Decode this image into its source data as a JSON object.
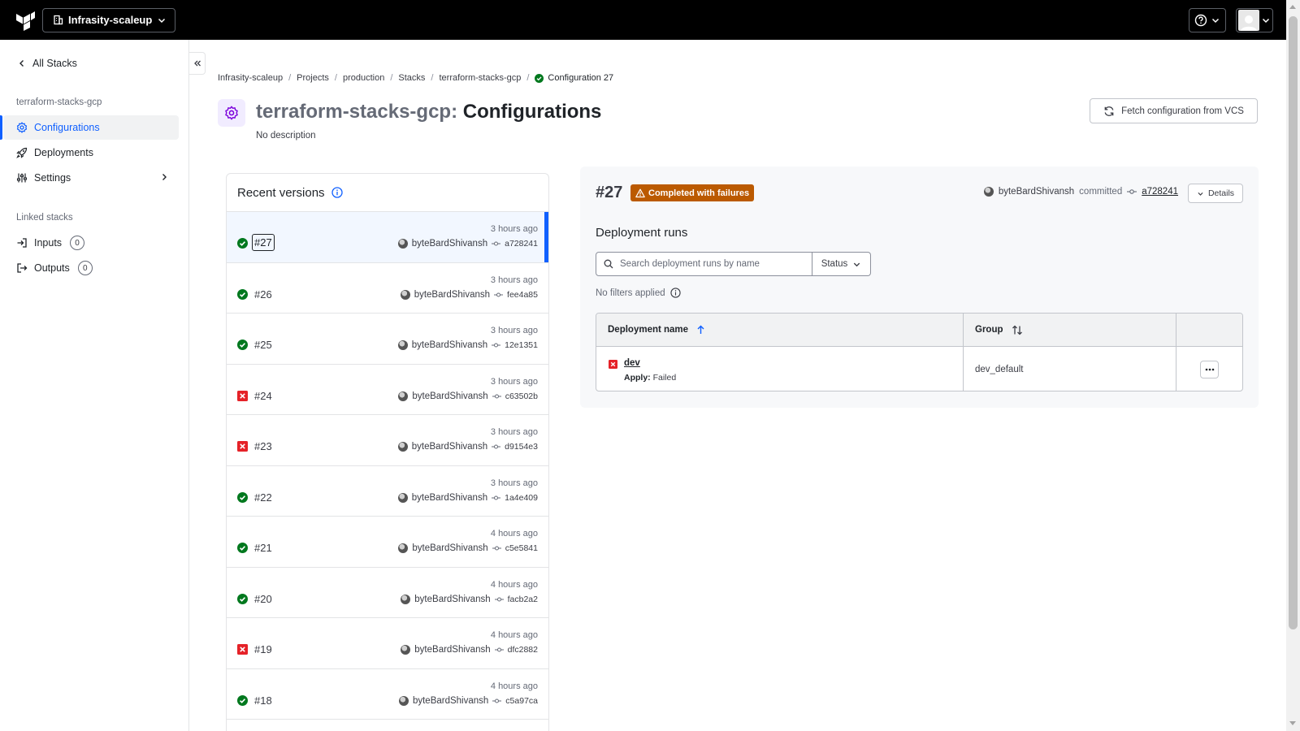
{
  "org": {
    "name": "Infrasity-scaleup"
  },
  "sidebar": {
    "back_label": "All Stacks",
    "stack_name": "terraform-stacks-gcp",
    "items": [
      {
        "label": "Configurations",
        "icon": "gear-icon",
        "active": true
      },
      {
        "label": "Deployments",
        "icon": "rocket-icon"
      },
      {
        "label": "Settings",
        "icon": "sliders-icon"
      }
    ],
    "linked_heading": "Linked stacks",
    "linked": [
      {
        "label": "Inputs",
        "count": "0",
        "icon": "login-icon"
      },
      {
        "label": "Outputs",
        "count": "0",
        "icon": "logout-icon"
      }
    ]
  },
  "breadcrumb": [
    "Infrasity-scaleup",
    "Projects",
    "production",
    "Stacks",
    "terraform-stacks-gcp",
    "Configuration 27"
  ],
  "page": {
    "title_prefix": "terraform-stacks-gcp:",
    "title_suffix": "Configurations",
    "description": "No description",
    "fetch_label": "Fetch configuration from VCS"
  },
  "versions": {
    "title": "Recent versions",
    "rows": [
      {
        "num": "#27",
        "status": "success",
        "time": "3 hours ago",
        "author": "byteBardShivansh",
        "sha": "a728241",
        "selected": true
      },
      {
        "num": "#26",
        "status": "success",
        "time": "3 hours ago",
        "author": "byteBardShivansh",
        "sha": "fee4a85"
      },
      {
        "num": "#25",
        "status": "success",
        "time": "3 hours ago",
        "author": "byteBardShivansh",
        "sha": "12e1351"
      },
      {
        "num": "#24",
        "status": "failed",
        "time": "3 hours ago",
        "author": "byteBardShivansh",
        "sha": "c63502b"
      },
      {
        "num": "#23",
        "status": "failed",
        "time": "3 hours ago",
        "author": "byteBardShivansh",
        "sha": "d9154e3"
      },
      {
        "num": "#22",
        "status": "success",
        "time": "3 hours ago",
        "author": "byteBardShivansh",
        "sha": "1a4e409"
      },
      {
        "num": "#21",
        "status": "success",
        "time": "4 hours ago",
        "author": "byteBardShivansh",
        "sha": "c5e5841"
      },
      {
        "num": "#20",
        "status": "success",
        "time": "4 hours ago",
        "author": "byteBardShivansh",
        "sha": "facb2a2"
      },
      {
        "num": "#19",
        "status": "failed",
        "time": "4 hours ago",
        "author": "byteBardShivansh",
        "sha": "dfc2882"
      },
      {
        "num": "#18",
        "status": "success",
        "time": "4 hours ago",
        "author": "byteBardShivansh",
        "sha": "c5a97ca"
      }
    ]
  },
  "details": {
    "num": "#27",
    "status_label": "Completed with failures",
    "author": "byteBardShivansh",
    "verb": "committed",
    "sha": "a728241",
    "details_label": "Details",
    "deployment_runs_title": "Deployment runs",
    "search_placeholder": "Search deployment runs by name",
    "status_filter_label": "Status",
    "no_filters": "No filters applied",
    "table": {
      "col_name": "Deployment name",
      "col_group": "Group",
      "rows": [
        {
          "name": "dev",
          "apply_label": "Apply:",
          "apply_status": "Failed",
          "group": "dev_default"
        }
      ]
    }
  },
  "colors": {
    "accent": "#1060ff",
    "success": "#00781e",
    "failure": "#e52228",
    "warning_badge": "#bb5a00"
  }
}
